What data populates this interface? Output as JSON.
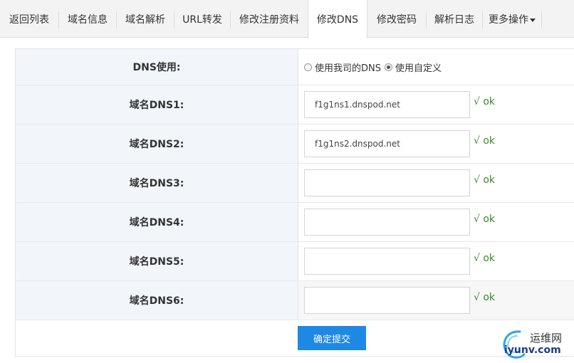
{
  "tabs": [
    {
      "label": "返回列表",
      "active": false
    },
    {
      "label": "域名信息",
      "active": false
    },
    {
      "label": "域名解析",
      "active": false
    },
    {
      "label": "URL转发",
      "active": false
    },
    {
      "label": "修改注册资料",
      "active": false
    },
    {
      "label": "修改DNS",
      "active": true
    },
    {
      "label": "修改密码",
      "active": false
    },
    {
      "label": "解析日志",
      "active": false
    },
    {
      "label": "更多操作",
      "active": false,
      "dropdown": true
    }
  ],
  "dns_usage": {
    "label": "DNS使用:",
    "option_ours": "使用我司的DNS",
    "option_custom": "使用自定义",
    "selected": "custom"
  },
  "dns_rows": [
    {
      "label": "域名DNS1:",
      "value": "f1g1ns1.dnspod.net",
      "status": "√ ok"
    },
    {
      "label": "域名DNS2:",
      "value": "f1g1ns2.dnspod.net",
      "status": "√ ok"
    },
    {
      "label": "域名DNS3:",
      "value": "",
      "status": "√ ok"
    },
    {
      "label": "域名DNS4:",
      "value": "",
      "status": "√ ok"
    },
    {
      "label": "域名DNS5:",
      "value": "",
      "status": "√ ok"
    },
    {
      "label": "域名DNS6:",
      "value": "",
      "status": "√ ok"
    }
  ],
  "submit_label": "确定提交",
  "watermark": {
    "name": "运维网",
    "domain": "iyunv.com"
  },
  "colors": {
    "accent": "#1e88e5",
    "ok": "#3a8a2c",
    "label_bg": "#f2f6fb"
  }
}
